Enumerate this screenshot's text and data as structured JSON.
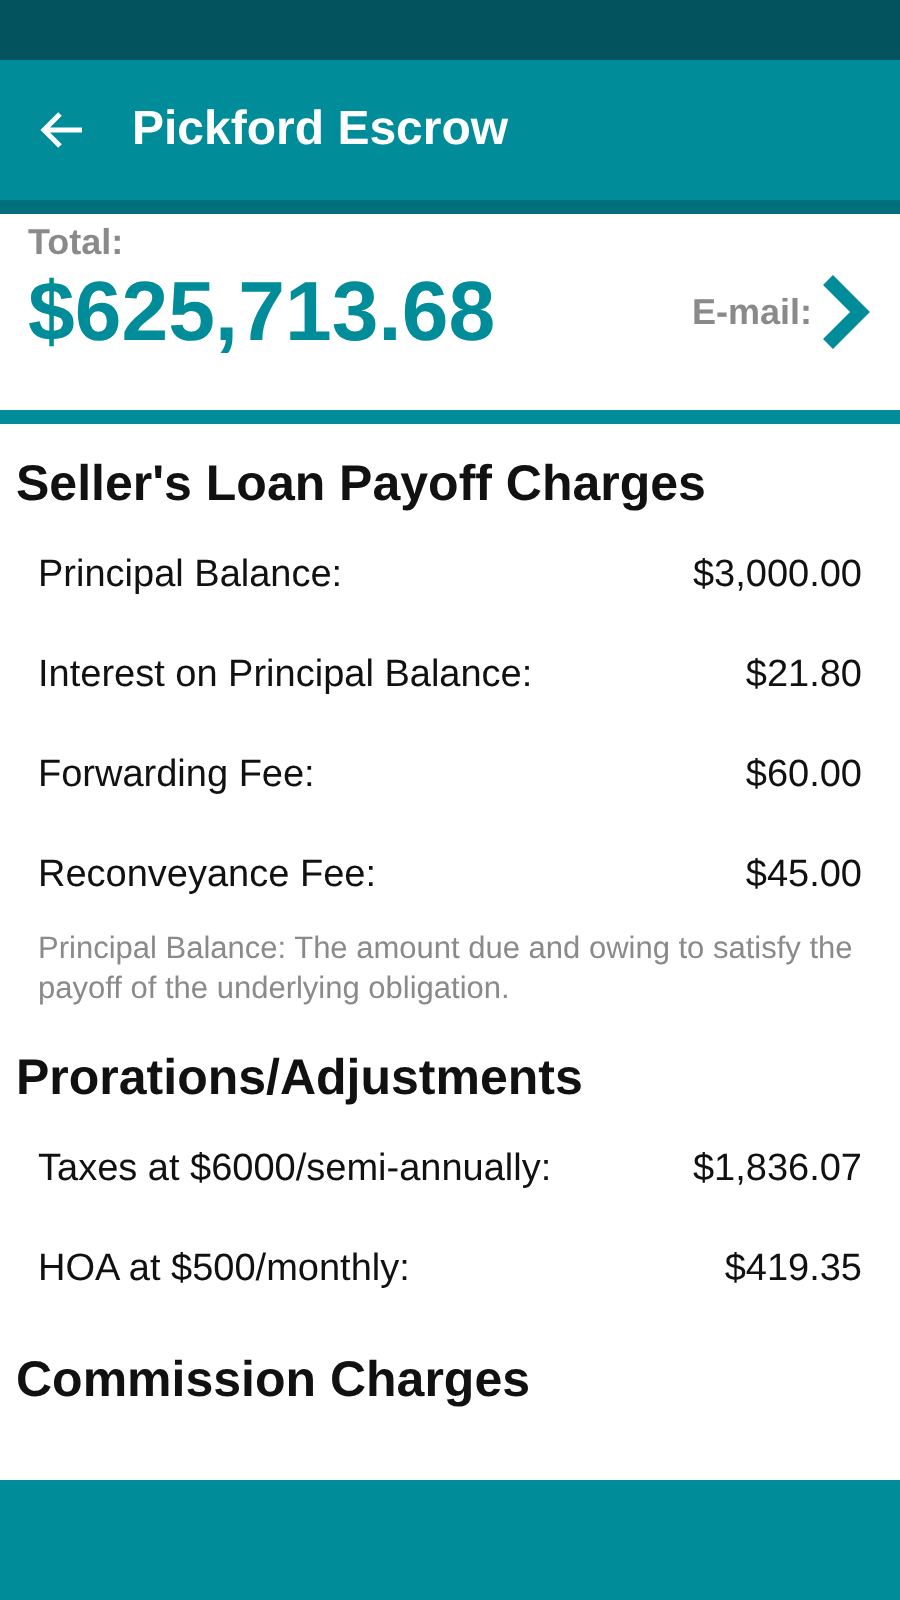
{
  "app_bar": {
    "title": "Pickford Escrow"
  },
  "summary": {
    "total_label": "Total:",
    "total": "$625,713.68",
    "email_label": "E-mail:"
  },
  "sections": [
    {
      "title": "Seller's Loan Payoff Charges",
      "rows": [
        {
          "label": "Principal Balance:",
          "amount": "$3,000.00"
        },
        {
          "label": "Interest on Principal Balance:",
          "amount": "$21.80"
        },
        {
          "label": "Forwarding Fee:",
          "amount": "$60.00"
        },
        {
          "label": "Reconveyance Fee:",
          "amount": "$45.00"
        }
      ],
      "note": "Principal Balance: The amount due and owing to satisfy the payoff of the underlying obligation."
    },
    {
      "title": "Prorations/Adjustments",
      "rows": [
        {
          "label": "Taxes at $6000/semi-annually:",
          "amount": "$1,836.07"
        },
        {
          "label": "HOA at $500/monthly:",
          "amount": "$419.35"
        }
      ]
    },
    {
      "title": "Commission Charges"
    }
  ]
}
